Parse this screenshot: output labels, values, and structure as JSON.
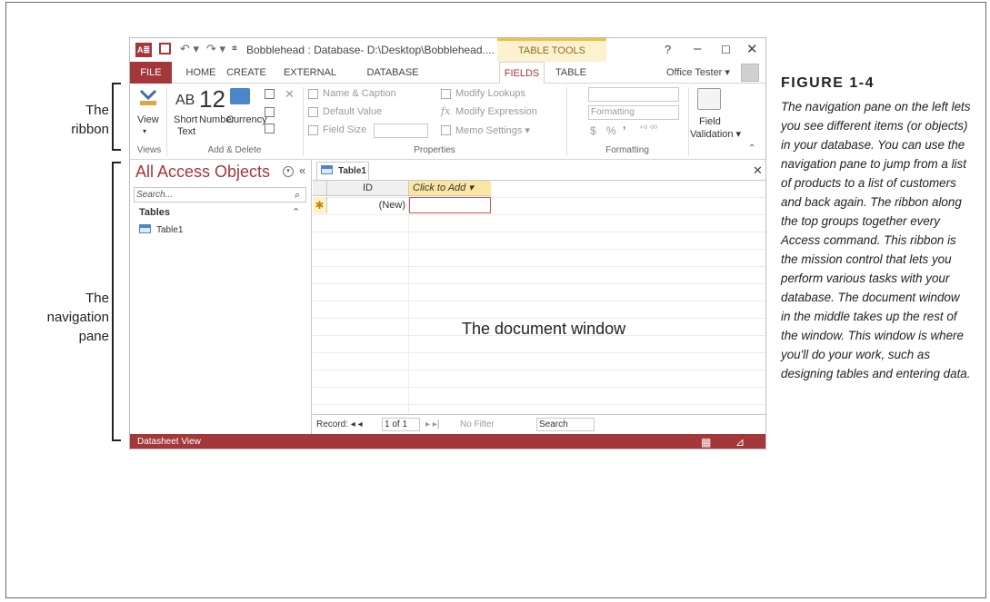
{
  "annotations": {
    "ribbon_label": "The ribbon",
    "nav_label": "The navigation pane",
    "doc_label": "The document window"
  },
  "caption": {
    "title": "FIGURE 1-4",
    "text": "The navigation pane on the left lets you see different items (or objects) in your database. You can use the navigation pane to jump from a list of products to a list of customers and back again. The ribbon along the top groups together every Access command. This ribbon is the mission control that lets you perform various tasks with your database. The document window in the middle takes up the rest of the window. This window is where you'll do your work, such as designing tables and entering data."
  },
  "window": {
    "title": "Bobblehead : Database- D:\\Desktop\\Bobblehead....",
    "app_logo": "A≣",
    "context_group": "TABLE TOOLS",
    "help": "?",
    "minimize": "–",
    "maximize": "☐",
    "close": "✕",
    "user": "Office Tester ▾"
  },
  "tabs": {
    "file": "FILE",
    "home": "HOME",
    "create": "CREATE",
    "external": "EXTERNAL DATA",
    "dbtools": "DATABASE TOOLS",
    "fields": "FIELDS",
    "table": "TABLE"
  },
  "ribbon": {
    "view": "View",
    "short_text_1": "Short",
    "short_text_2": "Text",
    "ab": "AB",
    "number_big": "12",
    "number": "Number",
    "currency": "Currency",
    "name_caption": "Name & Caption",
    "default_value": "Default Value",
    "field_size": "Field Size",
    "modify_lookups": "Modify Lookups",
    "modify_expression": "Modify Expression",
    "memo_settings": "Memo Settings ▾",
    "formatting": "Formatting",
    "dollar": "$",
    "percent": "%",
    "comma": "❜",
    "inc_dec": "⁺⁰ ⁰⁰",
    "field_validation_1": "Field",
    "field_validation_2": "Validation ▾",
    "groups": {
      "views": "Views",
      "add_delete": "Add & Delete",
      "properties": "Properties",
      "formatting": "Formatting"
    }
  },
  "nav": {
    "title": "All Access Objects",
    "collapse": "«",
    "search_placeholder": "Search...",
    "group": "Tables",
    "group_chevron": "⌃",
    "items": [
      {
        "label": "Table1"
      }
    ]
  },
  "doc": {
    "tab": "Table1",
    "close": "✕",
    "col_id": "ID",
    "col_add": "Click to Add ▾",
    "new_row": "(New)",
    "new_marker": "✱"
  },
  "record_bar": {
    "record_label": "Record: ◂ ◂",
    "record_value": "1 of 1",
    "nav_next": "▸ ▸|",
    "no_filter": "No Filter",
    "search": "Search"
  },
  "status": {
    "text": "Datasheet View"
  }
}
